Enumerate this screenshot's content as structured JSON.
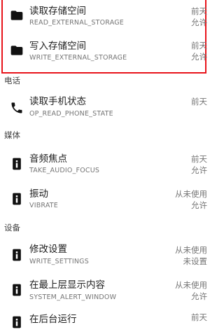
{
  "storage_items": [
    {
      "title": "读取存储空间",
      "sub": "READ_EXTERNAL_STORAGE",
      "when": "前天",
      "status": "允许",
      "icon": "folder-icon"
    },
    {
      "title": "写入存储空间",
      "sub": "WRITE_EXTERNAL_STORAGE",
      "when": "前天",
      "status": "允许",
      "icon": "folder-icon"
    }
  ],
  "sections": {
    "phone": "电话",
    "media": "媒体",
    "device": "设备"
  },
  "phone_items": [
    {
      "title": "读取手机状态",
      "sub": "OP_READ_PHONE_STATE",
      "when": "前天",
      "status": "",
      "icon": "phone-icon"
    }
  ],
  "media_items": [
    {
      "title": "音频焦点",
      "sub": "TAKE_AUDIO_FOCUS",
      "when": "前天",
      "status": "允许",
      "icon": "info-icon"
    },
    {
      "title": "振动",
      "sub": "VIBRATE",
      "when": "从未使用",
      "status": "允许",
      "icon": "info-icon"
    }
  ],
  "device_items": [
    {
      "title": "修改设置",
      "sub": "WRITE_SETTINGS",
      "when": "从未使用",
      "status": "未设置",
      "icon": "info-icon"
    },
    {
      "title": "在最上层显示内容",
      "sub": "SYSTEM_ALERT_WINDOW",
      "when": "从未使用",
      "status": "允许",
      "icon": "info-icon"
    },
    {
      "title": "在后台运行",
      "sub": "",
      "when": "前天",
      "status": "",
      "icon": "info-icon"
    }
  ],
  "colors": {
    "highlight_border": "#e8141b",
    "icon": "#111111",
    "secondary_text": "#757575"
  }
}
